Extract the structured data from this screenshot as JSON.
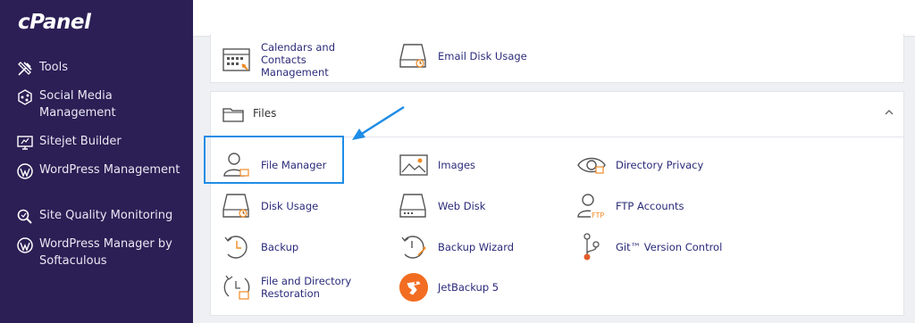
{
  "brand": {
    "logo_text": "cPanel"
  },
  "sidebar": {
    "items": [
      {
        "label": "Tools",
        "icon": "tools-icon"
      },
      {
        "label": "Social Media Management",
        "icon": "social-media-icon"
      },
      {
        "label": "Sitejet Builder",
        "icon": "sitejet-icon"
      },
      {
        "label": "WordPress Management",
        "icon": "wordpress-icon"
      },
      {
        "label": "Site Quality Monitoring",
        "icon": "site-quality-icon"
      },
      {
        "label": "WordPress Manager by Softaculous",
        "icon": "wordpress-icon"
      }
    ]
  },
  "email_section": {
    "tools": [
      {
        "label": "Calendars and Contacts Management",
        "icon": "calendar-icon"
      },
      {
        "label": "Email Disk Usage",
        "icon": "disk-usage-icon"
      }
    ]
  },
  "files_section": {
    "title": "Files",
    "tools": [
      {
        "label": "File Manager",
        "icon": "file-manager-icon"
      },
      {
        "label": "Images",
        "icon": "images-icon"
      },
      {
        "label": "Directory Privacy",
        "icon": "eye-icon"
      },
      {
        "label": "Disk Usage",
        "icon": "disk-usage-icon"
      },
      {
        "label": "Web Disk",
        "icon": "web-disk-icon"
      },
      {
        "label": "FTP Accounts",
        "icon": "ftp-icon"
      },
      {
        "label": "Backup",
        "icon": "backup-icon"
      },
      {
        "label": "Backup Wizard",
        "icon": "backup-wizard-icon"
      },
      {
        "label": "Git™ Version Control",
        "icon": "git-icon"
      },
      {
        "label": "File and Directory Restoration",
        "icon": "restore-icon"
      },
      {
        "label": "JetBackup 5",
        "icon": "jetbackup-icon"
      }
    ]
  },
  "colors": {
    "sidebar_bg": "#2b1f55",
    "link_text": "#2a2a7a",
    "accent_orange": "#f08a24",
    "highlight_blue": "#1f8de6"
  }
}
